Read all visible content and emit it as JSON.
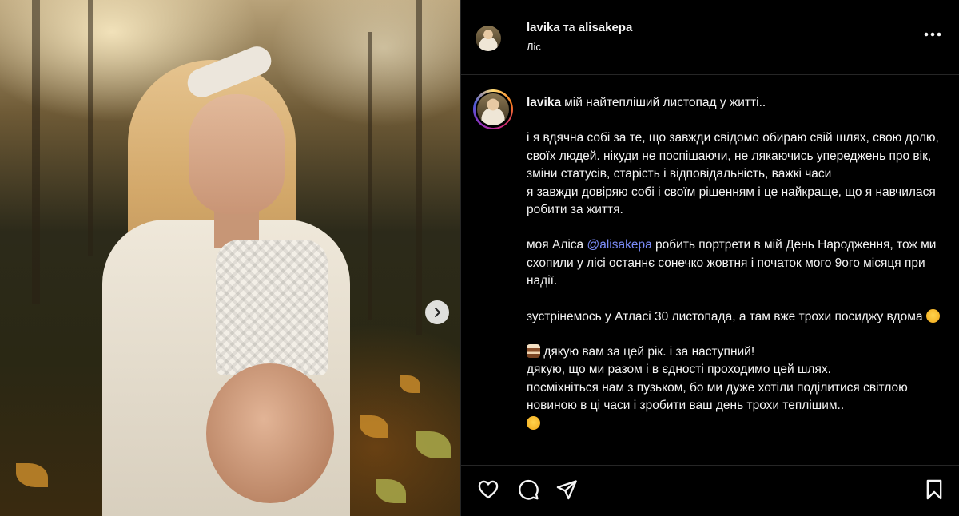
{
  "header": {
    "author": "lavika",
    "conjunction": "та",
    "collaborator": "alisakepa",
    "location": "Ліс"
  },
  "caption": {
    "username": "lavika",
    "first_line": "мій найтепліший листопад у житті..",
    "para1": [
      "і я вдячна собі за те, що завжди свідомо обираю свій шлях, свою долю, своїх людей. нікуди не поспішаючи, не лякаючись упереджень про вік, зміни статусів, старість і відповідальність, важкі часи",
      "я завжди довіряю собі і своїм рішенням і це найкраще, що я навчилася робити за життя."
    ],
    "para2_before": "моя Аліса",
    "para2_mention": "@alisakepa",
    "para2_after": "робить портрети в мій День Народження, тож ми схопили у лісі останнє сонечко жовтня і початок мого 9ого місяця при надії.",
    "para3": "зустрінемось у Атласі 30 листопада, а там вже трохи посиджу вдома",
    "para4_first": "дякую вам за цей рік. і за наступний!",
    "para4_rest": [
      "дякую, що ми разом і в єдності проходимо цей шлях.",
      "посміхніться нам з пузьком, бо ми дуже хотіли поділитися світлою новиною в ці часи і зробити ваш день трохи теплішим.."
    ]
  },
  "icons": {
    "more": "more-options-icon",
    "like": "heart-icon",
    "comment": "comment-bubble-icon",
    "share": "paper-plane-icon",
    "save": "bookmark-icon",
    "carousel": "chevron-right-icon"
  },
  "colors": {
    "background": "#000000",
    "text": "#f5f5f5",
    "mention": "#7b8cf8",
    "divider": "#262626"
  }
}
